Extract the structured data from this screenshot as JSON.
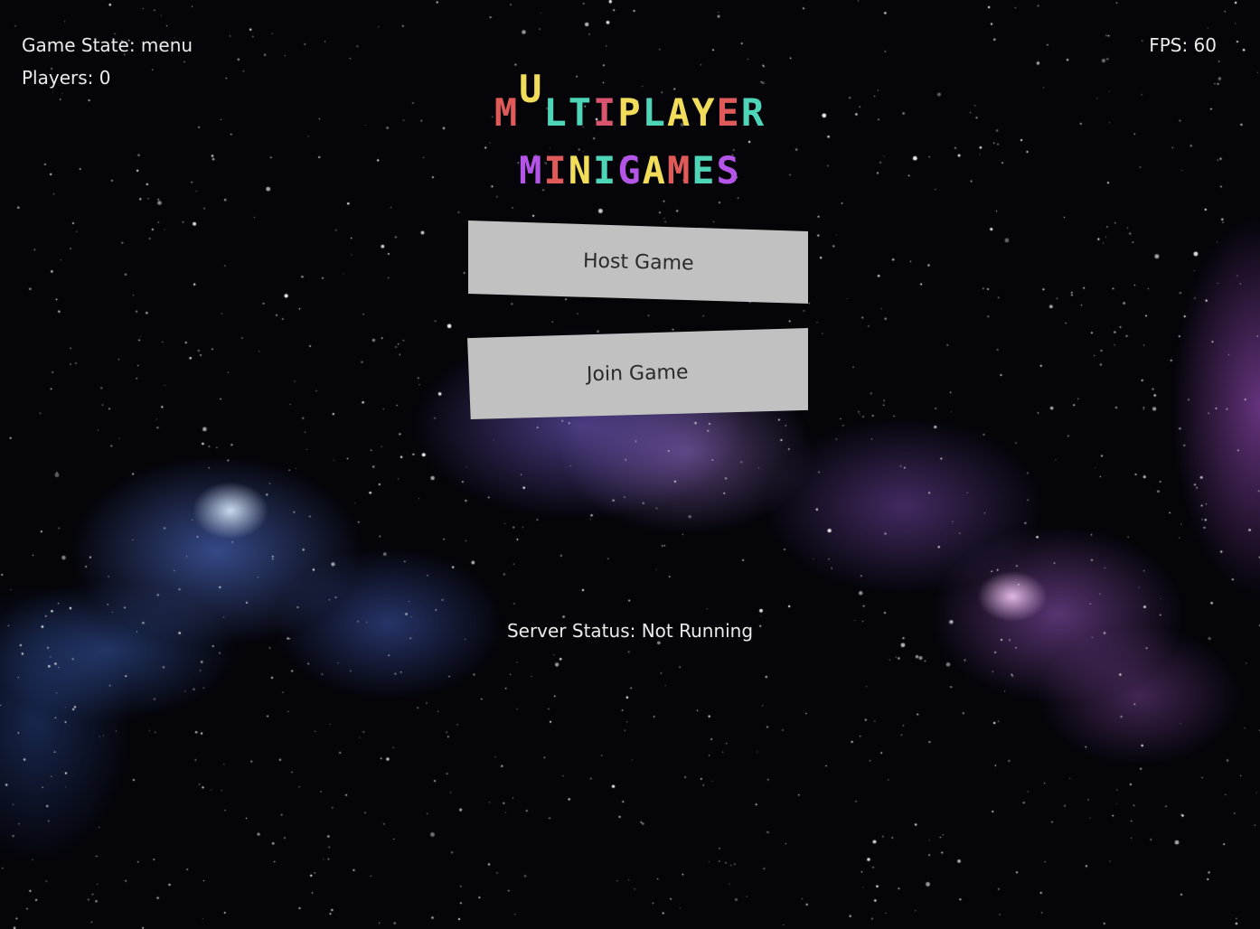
{
  "hud": {
    "game_state": "Game State: menu",
    "players": "Players: 0",
    "fps": "FPS: 60"
  },
  "title": {
    "line1": [
      {
        "ch": "M",
        "color": "#e05a5a",
        "raised": false
      },
      {
        "ch": "U",
        "color": "#f2dd5a",
        "raised": true
      },
      {
        "ch": "L",
        "color": "#4ed4b6",
        "raised": false
      },
      {
        "ch": "T",
        "color": "#4ed4b6",
        "raised": false
      },
      {
        "ch": "I",
        "color": "#d9556e",
        "raised": false
      },
      {
        "ch": "P",
        "color": "#f2dd5a",
        "raised": false
      },
      {
        "ch": "L",
        "color": "#4ed4b6",
        "raised": false
      },
      {
        "ch": "A",
        "color": "#f2dd5a",
        "raised": false
      },
      {
        "ch": "Y",
        "color": "#f2dd5a",
        "raised": false
      },
      {
        "ch": "E",
        "color": "#e05a5a",
        "raised": false
      },
      {
        "ch": "R",
        "color": "#4ed4b6",
        "raised": false
      }
    ],
    "line2": [
      {
        "ch": "M",
        "color": "#b455e8",
        "raised": false
      },
      {
        "ch": "I",
        "color": "#e05a5a",
        "raised": false
      },
      {
        "ch": "N",
        "color": "#f2dd5a",
        "raised": false
      },
      {
        "ch": "I",
        "color": "#4ed4b6",
        "raised": false
      },
      {
        "ch": "G",
        "color": "#b455e8",
        "raised": false
      },
      {
        "ch": "A",
        "color": "#f2dd5a",
        "raised": false
      },
      {
        "ch": "M",
        "color": "#e05a5a",
        "raised": false
      },
      {
        "ch": "E",
        "color": "#4ed4b6",
        "raised": false
      },
      {
        "ch": "S",
        "color": "#b455e8",
        "raised": false
      }
    ]
  },
  "menu": {
    "host_label": "Host Game",
    "join_label": "Join Game"
  },
  "server": {
    "status": "Server Status: Not Running"
  },
  "colors": {
    "button_bg": "#c1c1c1",
    "hud_text": "#ececec",
    "space_bg": "#040409"
  }
}
